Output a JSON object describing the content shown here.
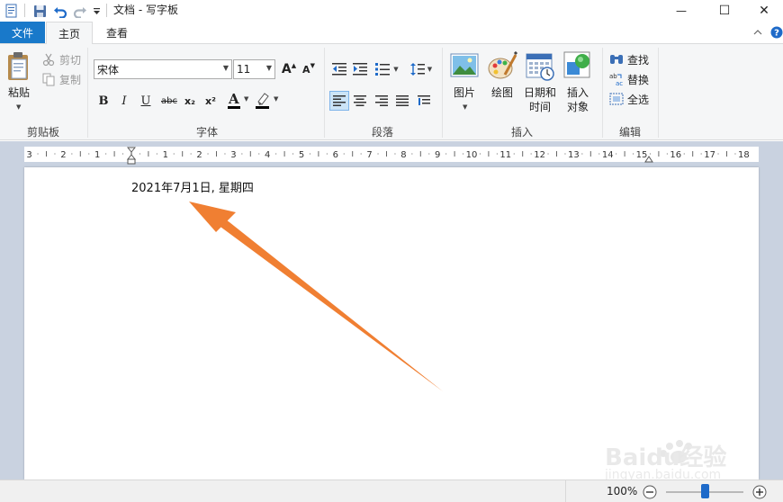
{
  "window": {
    "title": "文档 - 写字板",
    "minimize_glyph": "—",
    "maximize_glyph": "☐",
    "close_glyph": "✕"
  },
  "quick_access": {
    "save_icon": "save-icon",
    "undo_icon": "undo-icon",
    "redo_icon": "redo-icon",
    "customize_icon": "customize-dropdown-icon"
  },
  "tabs": {
    "file": "文件",
    "home": "主页",
    "view": "查看"
  },
  "ribbon": {
    "clipboard": {
      "group_label": "剪贴板",
      "paste": "粘贴",
      "cut": "剪切",
      "copy": "复制"
    },
    "font": {
      "group_label": "字体",
      "family": "宋体",
      "size": "11",
      "grow_label": "A",
      "shrink_label": "A",
      "bold": "B",
      "italic": "I",
      "underline": "U",
      "strikethrough": "abc",
      "subscript": "x₂",
      "superscript": "x²",
      "font_color_label": "A"
    },
    "paragraph": {
      "group_label": "段落"
    },
    "insert": {
      "group_label": "插入",
      "picture": "图片",
      "paint": "绘图",
      "datetime_line1": "日期和",
      "datetime_line2": "时间",
      "object_line1": "插入",
      "object_line2": "对象"
    },
    "editing": {
      "group_label": "编辑",
      "find": "查找",
      "replace": "替换",
      "select_all": "全选"
    }
  },
  "ruler": {
    "labels": [
      "3",
      "2",
      "1",
      "1",
      "2",
      "3",
      "4",
      "5",
      "6",
      "7",
      "8",
      "9",
      "10",
      "11",
      "12",
      "13",
      "14",
      "15",
      "16",
      "17",
      "18"
    ]
  },
  "document": {
    "text": "2021年7月1日, 星期四"
  },
  "status": {
    "zoom": "100%"
  },
  "watermark": {
    "brand": "Baidu经验",
    "url": "jingyan.baidu.com"
  },
  "colors": {
    "file_tab": "#1979ca",
    "annotation_arrow": "#f07f32",
    "ribbon_bg": "#f5f6f7",
    "workspace_bg": "#c9d2e0"
  }
}
